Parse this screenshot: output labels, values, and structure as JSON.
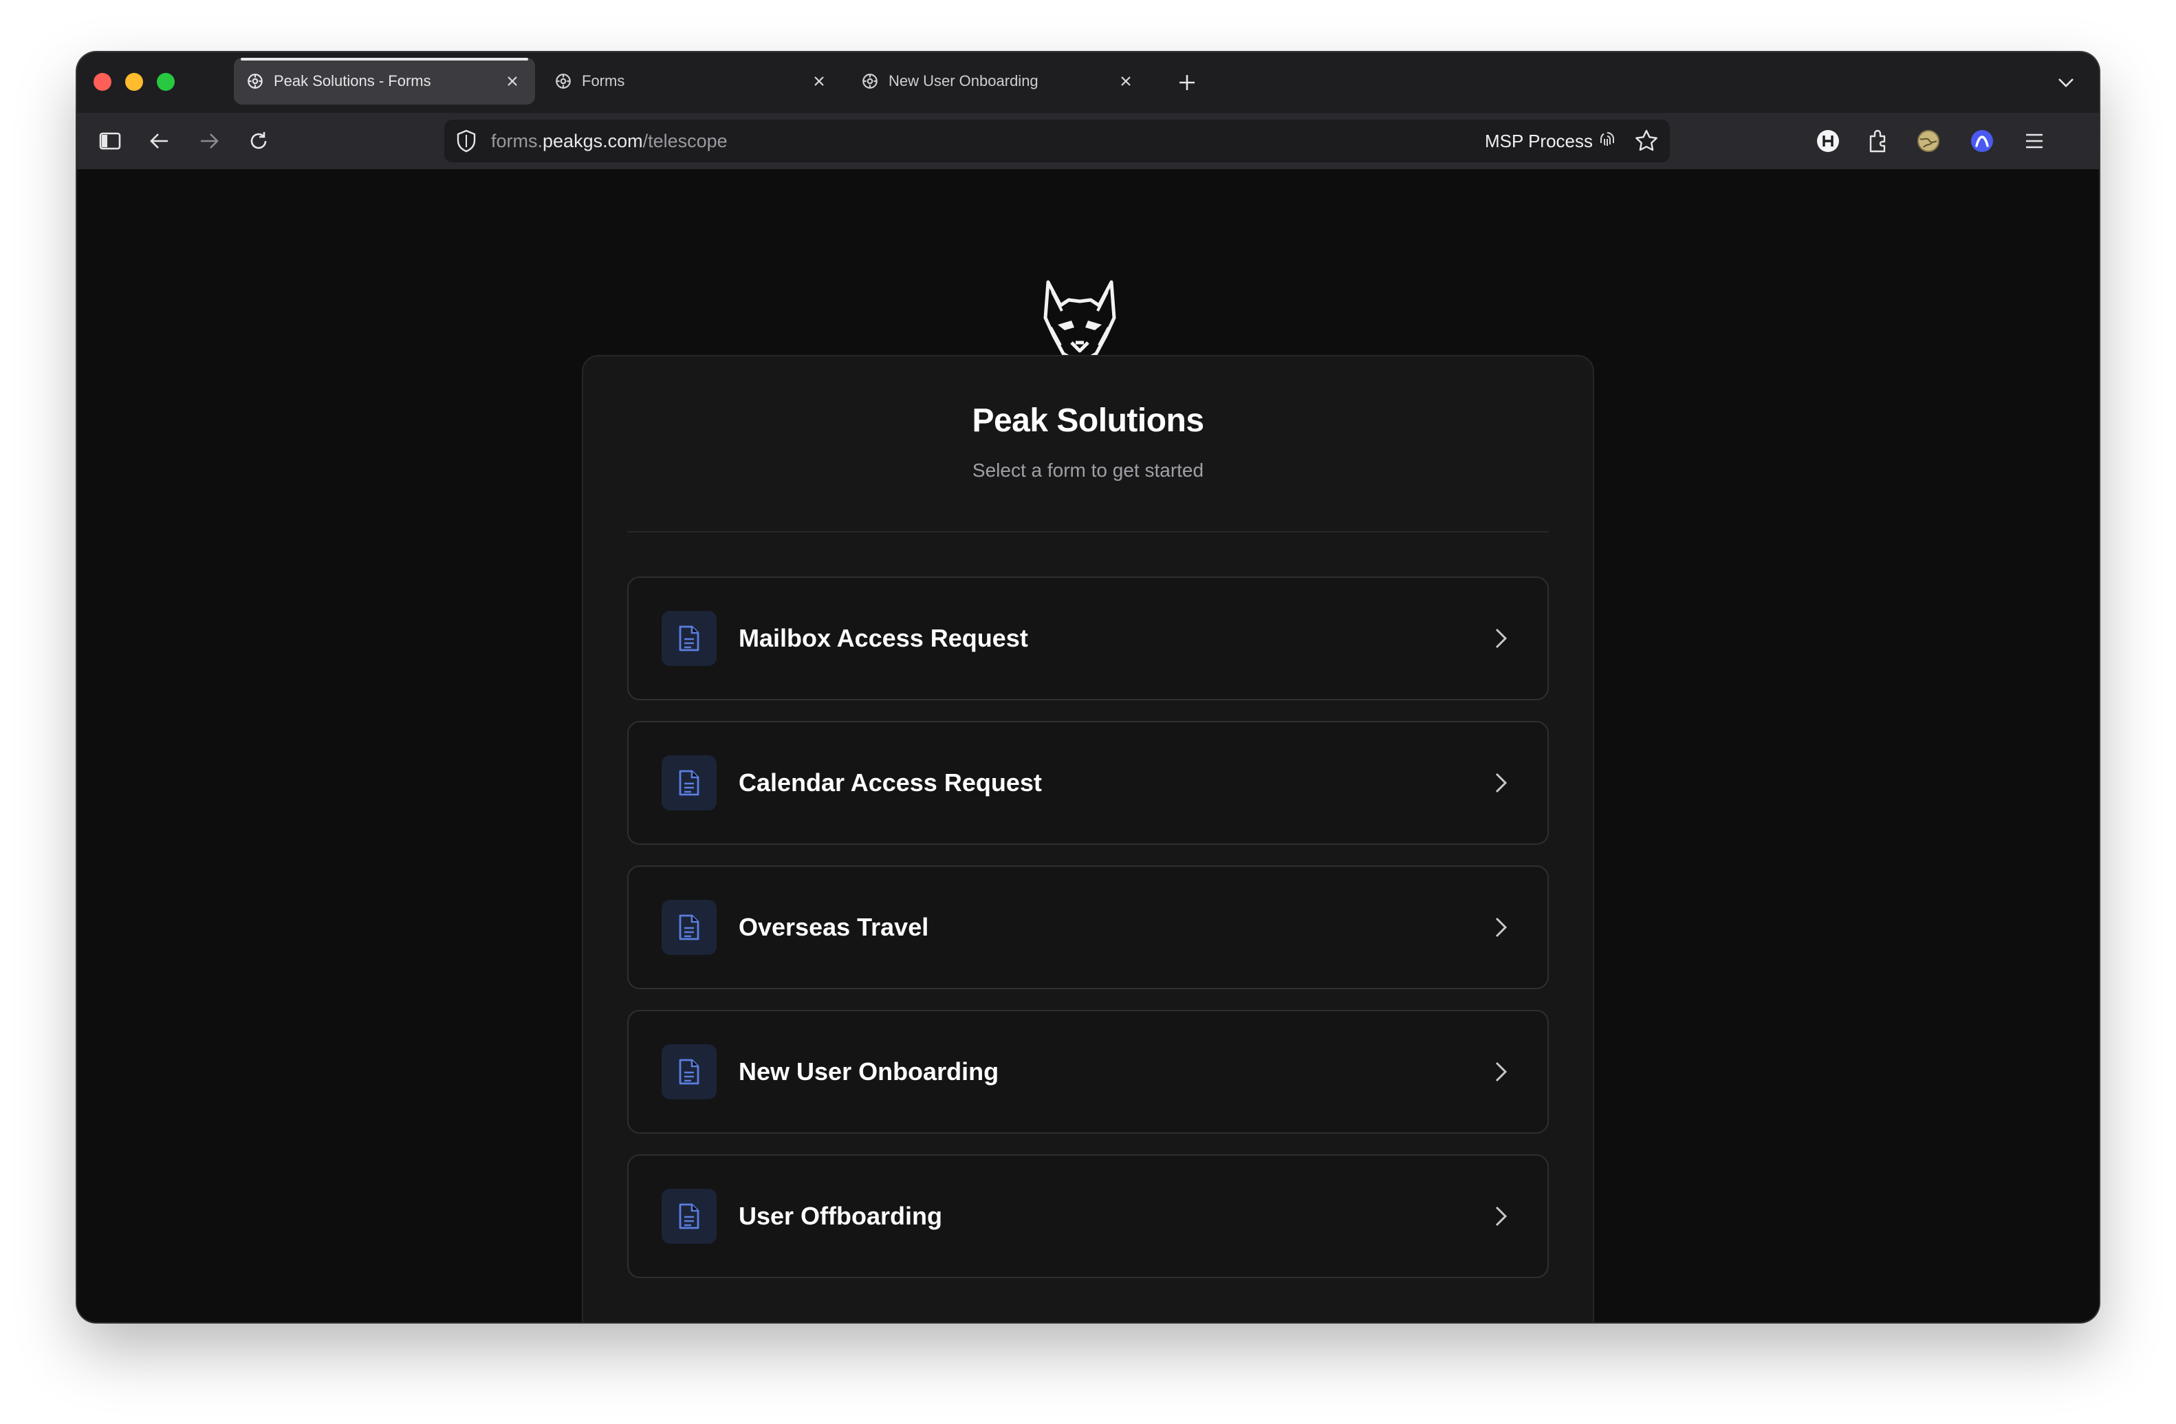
{
  "browser": {
    "tabs": [
      {
        "label": "Peak Solutions - Forms",
        "active": true
      },
      {
        "label": "Forms",
        "active": false
      },
      {
        "label": "New User Onboarding",
        "active": false
      }
    ],
    "url": {
      "prefix": "forms.",
      "host": "peakgs.com",
      "path": "/telescope"
    },
    "url_right_label": "MSP Process"
  },
  "page": {
    "title": "Peak Solutions",
    "subtitle": "Select a form to get started",
    "forms": [
      {
        "label": "Mailbox Access Request"
      },
      {
        "label": "Calendar Access Request"
      },
      {
        "label": "Overseas Travel"
      },
      {
        "label": "New User Onboarding"
      },
      {
        "label": "User Offboarding"
      }
    ]
  },
  "colors": {
    "accent_icon": "#5b7fe0",
    "page_background": "#0d0d0e",
    "card_background": "#171718"
  }
}
